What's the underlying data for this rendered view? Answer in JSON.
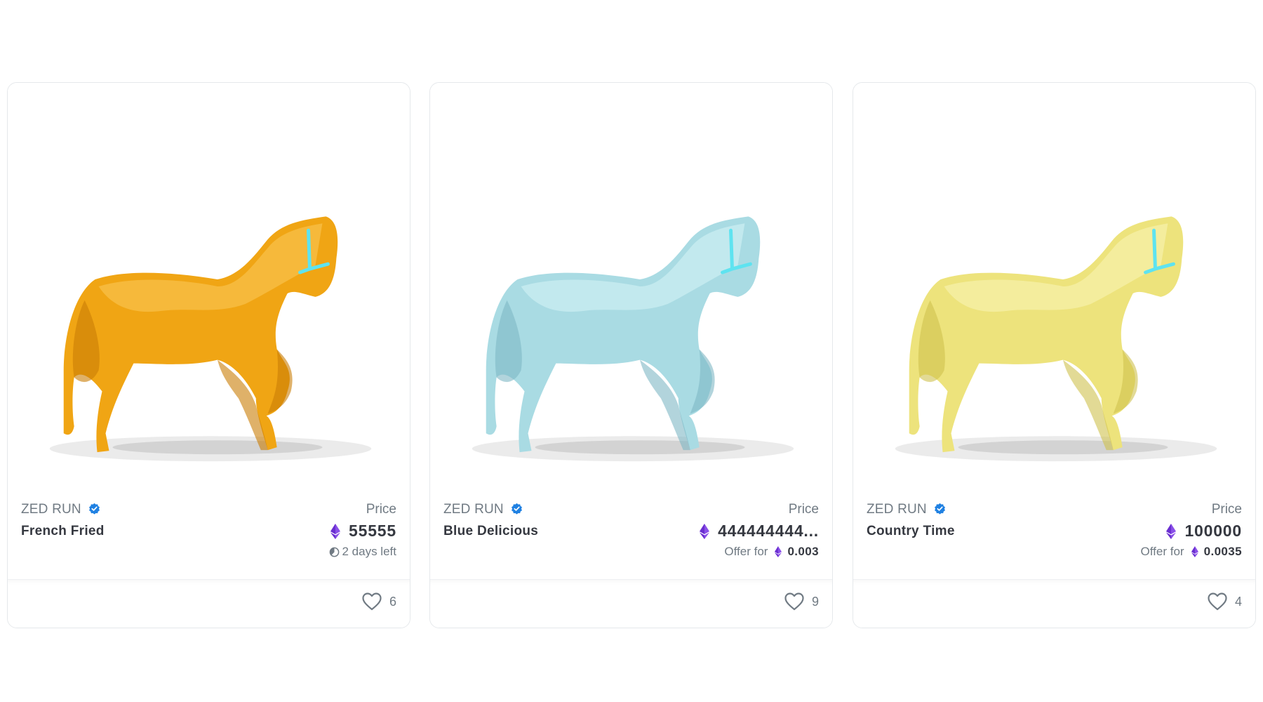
{
  "cards": [
    {
      "collection": "ZED RUN",
      "name": "French Fried",
      "price_label": "Price",
      "price": "55555",
      "sub_text": "2 days left",
      "likes": "6",
      "horse_colors": {
        "base": "#f0a514",
        "light": "#f8c048",
        "dark": "#c97d05"
      }
    },
    {
      "collection": "ZED RUN",
      "name": "Blue Delicious",
      "price_label": "Price",
      "price": "444444444...",
      "offer_label": "Offer for",
      "offer_value": "0.003",
      "likes": "9",
      "horse_colors": {
        "base": "#a9dbe3",
        "light": "#cbeef2",
        "dark": "#7fb8c4"
      }
    },
    {
      "collection": "ZED RUN",
      "name": "Country Time",
      "price_label": "Price",
      "price": "100000",
      "offer_label": "Offer for",
      "offer_value": "0.0035",
      "likes": "4",
      "horse_colors": {
        "base": "#ede37c",
        "light": "#f6f0a8",
        "dark": "#cfc24e"
      }
    }
  ],
  "icons": {
    "currency": "ethereum-icon",
    "verified": "verified-badge-icon",
    "like": "heart-icon",
    "timer": "clock-icon"
  },
  "colors": {
    "eth": "#7b3fe4",
    "verified": "#2081e2",
    "halter": "#5ee3f0"
  }
}
